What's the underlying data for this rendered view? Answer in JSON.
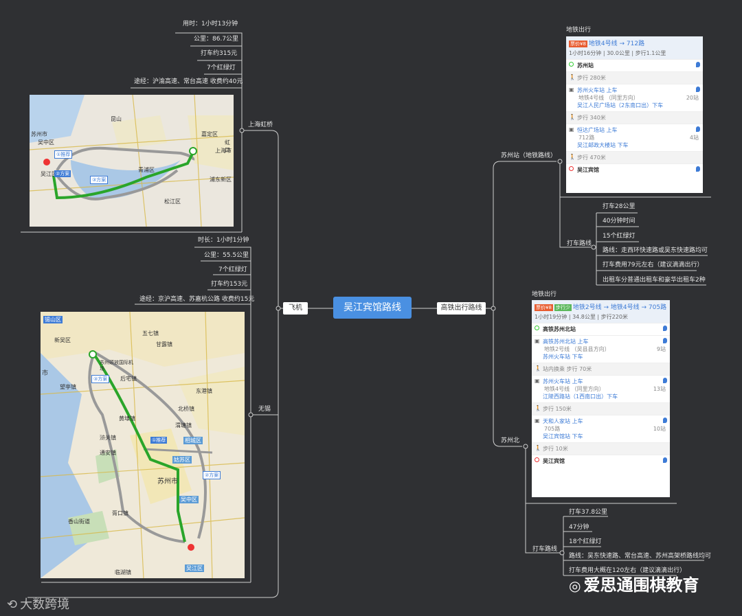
{
  "central": "吴江宾馆路线",
  "left_branch": "飞机",
  "right_branch": "高铁出行路线",
  "hongqiao": {
    "label": "上海虹桥",
    "items": [
      "用时：1小时13分钟",
      "公里：86.7公里",
      "打车约315元",
      "7个红绿灯",
      "途经：沪渝高速、常台高速 收费约40元"
    ],
    "map": {
      "labels": [
        "苏州市",
        "吴中区",
        "吴江区",
        "嘉定区",
        "青浦区",
        "上海市",
        "松江区",
        "虹口",
        "浦东新区",
        "昆山"
      ],
      "route_badges": [
        {
          "num": "①",
          "text": "推荐"
        },
        {
          "num": "②",
          "text": "方案"
        },
        {
          "num": "③",
          "text": "方案"
        }
      ]
    }
  },
  "wuxi": {
    "label": "无锡",
    "items": [
      "时长：1小时1分钟",
      "公里：55.5公里",
      "7个红绿灯",
      "打车约153元",
      "途经：京沪高速、苏嘉杭公路 收费约15元"
    ],
    "map": {
      "labels": [
        "锡山区",
        "新吴区",
        "五七镇",
        "甘露镇",
        "苏州硕放国际机场",
        "后宅镇",
        "望亭镇",
        "东港镇",
        "北桥镇",
        "黄埭镇",
        "浒关镇",
        "渭塘镇",
        "通安镇",
        "相城区",
        "姑苏区",
        "苏州市",
        "吴中区",
        "胥口镇",
        "香山街道",
        "吴江区",
        "临湖镇",
        "市"
      ],
      "route_badges": [
        {
          "num": "①",
          "text": "推荐"
        },
        {
          "num": "②",
          "text": "方案"
        },
        {
          "num": "③",
          "text": "方案"
        }
      ]
    }
  },
  "suzhou_station": {
    "label": "苏州站（地铁路线）",
    "card_title": "地铁出行",
    "card": {
      "tag": "票价¥8",
      "route": "地铁4号线 → 712路",
      "meta": [
        "1小时16分钟",
        "30.0公里",
        "步行1.1公里"
      ],
      "rows": [
        {
          "type": "start",
          "text": "苏州站"
        },
        {
          "type": "walk",
          "text": "步行 280米"
        },
        {
          "type": "bus",
          "text": "苏州火车站 上车",
          "sub": "地铁4号线 （同里方向）",
          "right": "20站",
          "text2": "吴江人民广场站（2东南口出）下车"
        },
        {
          "type": "walk",
          "text": "步行 340米"
        },
        {
          "type": "bus",
          "text": "恒达广场站 上车",
          "sub": "712路",
          "right": "4站",
          "text2": "吴江邮政大楼站 下车"
        },
        {
          "type": "walk",
          "text": "步行 470米"
        },
        {
          "type": "end",
          "text": "吴江宾馆"
        }
      ]
    },
    "taxi_label": "打车路线",
    "taxi": [
      "打车28公里",
      "40分钟时间",
      "15个红绿灯",
      "路线：走西环快速路或吴东快速路均可",
      "打车费用79元左右（建议滴滴出行）",
      "出租车分普通出租车和豪华出租车2种"
    ]
  },
  "suzhou_north": {
    "label": "苏州北",
    "card_title": "地铁出行",
    "card": {
      "tag": "票价¥8",
      "tag2": "步行少",
      "route": "地铁2号线 → 地铁4号线 → 705路",
      "meta": [
        "1小时19分钟",
        "34.8公里",
        "步行220米"
      ],
      "rows": [
        {
          "type": "start",
          "text": "高铁苏州北站"
        },
        {
          "type": "bus",
          "text": "高铁苏州北站 上车",
          "sub": "地铁2号线 （吴县县方向）",
          "right": "9站",
          "text2": "苏州火车站 下车"
        },
        {
          "type": "walk",
          "text": "站内换乘 步行 70米"
        },
        {
          "type": "bus",
          "text": "苏州火车站 上车",
          "sub": "地铁4号线 （同里方向）",
          "right": "13站",
          "text2": "江陵西路站（1西南口出）下车"
        },
        {
          "type": "walk",
          "text": "步行 150米"
        },
        {
          "type": "bus",
          "text": "天和人家站 上车",
          "sub": "705路",
          "right": "10站",
          "text2": "吴江宾馆站 下车"
        },
        {
          "type": "walk",
          "text": "步行 10米"
        },
        {
          "type": "end",
          "text": "吴江宾馆"
        }
      ]
    },
    "taxi_label": "打车路线",
    "taxi": [
      "打车37.8公里",
      "47分钟",
      "18个红绿灯",
      "路线：吴东快速路、常台高速、苏州高架桥路线均可",
      "打车费用大概在120左右（建议滴滴出行）"
    ]
  },
  "watermark_wechat": "爱思通围棋教育",
  "watermark_logo": "大数跨境",
  "colors": {
    "background": "#2f3033",
    "central": "#4a90e2",
    "route": "#2aa52a",
    "alt_route": "#9a9a9a",
    "link": "#3d7bd6"
  }
}
